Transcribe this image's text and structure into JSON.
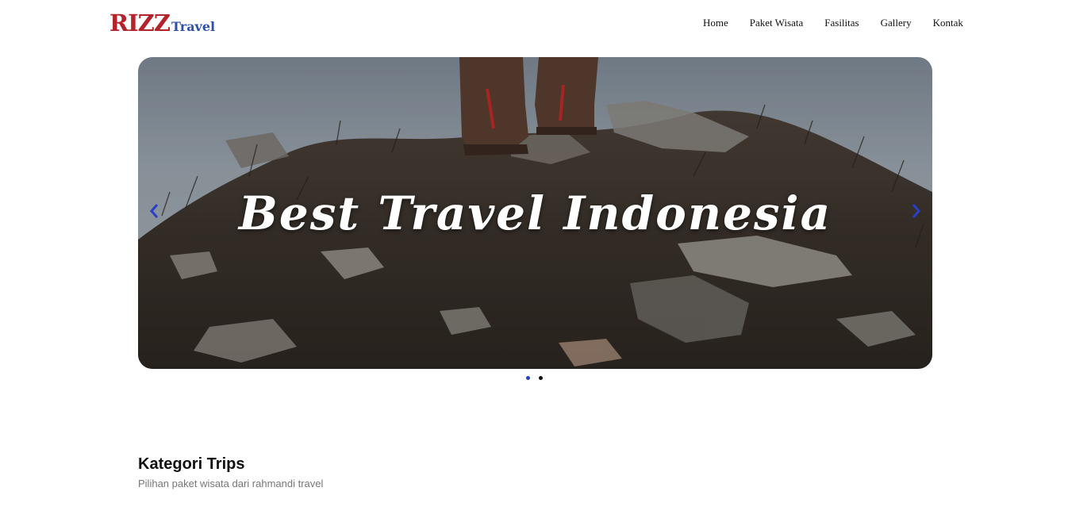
{
  "brand": {
    "main": "RIZZ",
    "sub": "Travel",
    "main_color": "#b5232a",
    "sub_color": "#2c4fb0"
  },
  "nav": {
    "items": [
      "Home",
      "Paket Wisata",
      "Fasilitas",
      "Gallery",
      "Kontak"
    ]
  },
  "hero": {
    "caption": "Best Travel Indonesia",
    "prev_icon": "chevron-left-icon",
    "next_icon": "chevron-right-icon",
    "slide_count": 2,
    "active_slide": 1,
    "accent_color": "#2347b8"
  },
  "section": {
    "title": "Kategori Trips",
    "subtitle": "Pilihan paket wisata dari rahmandi travel"
  }
}
